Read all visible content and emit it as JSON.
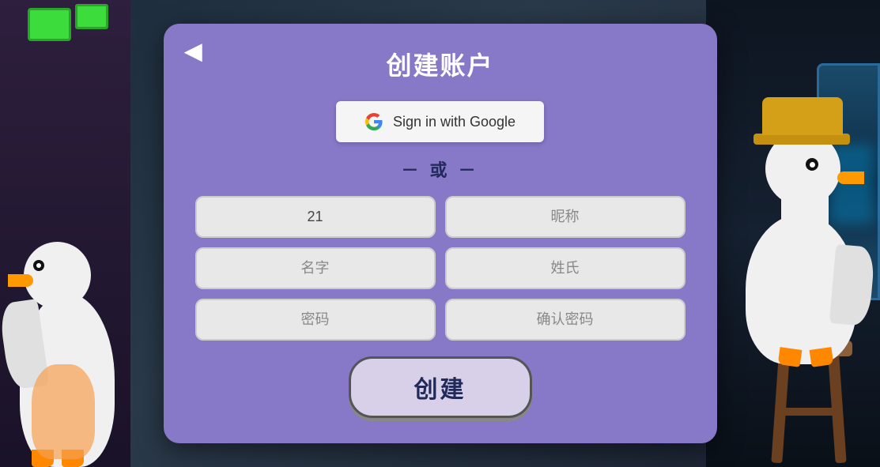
{
  "page": {
    "title": "创建账户",
    "back_label": "◀",
    "google_btn_label": "Sign in with Google",
    "or_divider": "－ 或 －",
    "fields": [
      {
        "id": "username",
        "placeholder": "21",
        "value": "21"
      },
      {
        "id": "nickname",
        "placeholder": "昵称",
        "value": ""
      },
      {
        "id": "firstname",
        "placeholder": "名字",
        "value": ""
      },
      {
        "id": "lastname",
        "placeholder": "姓氏",
        "value": ""
      },
      {
        "id": "password",
        "placeholder": "密码",
        "value": ""
      },
      {
        "id": "confirm-password",
        "placeholder": "确认密码",
        "value": ""
      }
    ],
    "create_btn_label": "创建",
    "colors": {
      "dialog_bg": "#8878c8",
      "button_bg": "#d8d0e8"
    }
  }
}
